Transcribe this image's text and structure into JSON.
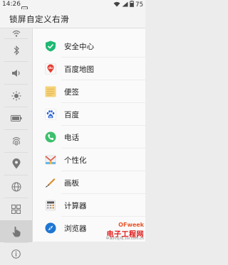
{
  "status_bar": {
    "time": "14:26",
    "battery": "75"
  },
  "header": {
    "title": "锁屏自定义右滑"
  },
  "sidebar": {
    "items": [
      {
        "icon": "wifi-icon"
      },
      {
        "icon": "bluetooth-icon"
      },
      {
        "icon": "volume-icon"
      },
      {
        "icon": "brightness-icon"
      },
      {
        "icon": "battery-icon"
      },
      {
        "icon": "fingerprint-icon"
      },
      {
        "icon": "location-icon"
      },
      {
        "icon": "globe-icon"
      },
      {
        "icon": "apps-grid-icon"
      },
      {
        "icon": "hand-pointer-icon",
        "selected": true
      },
      {
        "icon": "info-icon"
      }
    ]
  },
  "apps": [
    {
      "label": "安全中心",
      "icon": "security-center-icon"
    },
    {
      "label": "百度地图",
      "icon": "baidu-map-icon"
    },
    {
      "label": "便签",
      "icon": "notes-icon"
    },
    {
      "label": "百度",
      "icon": "baidu-icon"
    },
    {
      "label": "电话",
      "icon": "phone-icon"
    },
    {
      "label": "个性化",
      "icon": "personalize-icon"
    },
    {
      "label": "画板",
      "icon": "drawing-board-icon"
    },
    {
      "label": "计算器",
      "icon": "calculator-icon"
    },
    {
      "label": "浏览器",
      "icon": "browser-icon"
    }
  ],
  "watermark": {
    "brand": "OFweek",
    "site_name": "电子工程网",
    "sub": "中关村在线",
    "domain": "zol.com.cn"
  },
  "colors": {
    "security_green": "#1fb872",
    "phone_green": "#3cc06c",
    "baidu_blue": "#2a63d6",
    "map_red": "#e63b2e",
    "notes_yellow": "#f5d27a",
    "watermark_red": "#e01a1a"
  }
}
